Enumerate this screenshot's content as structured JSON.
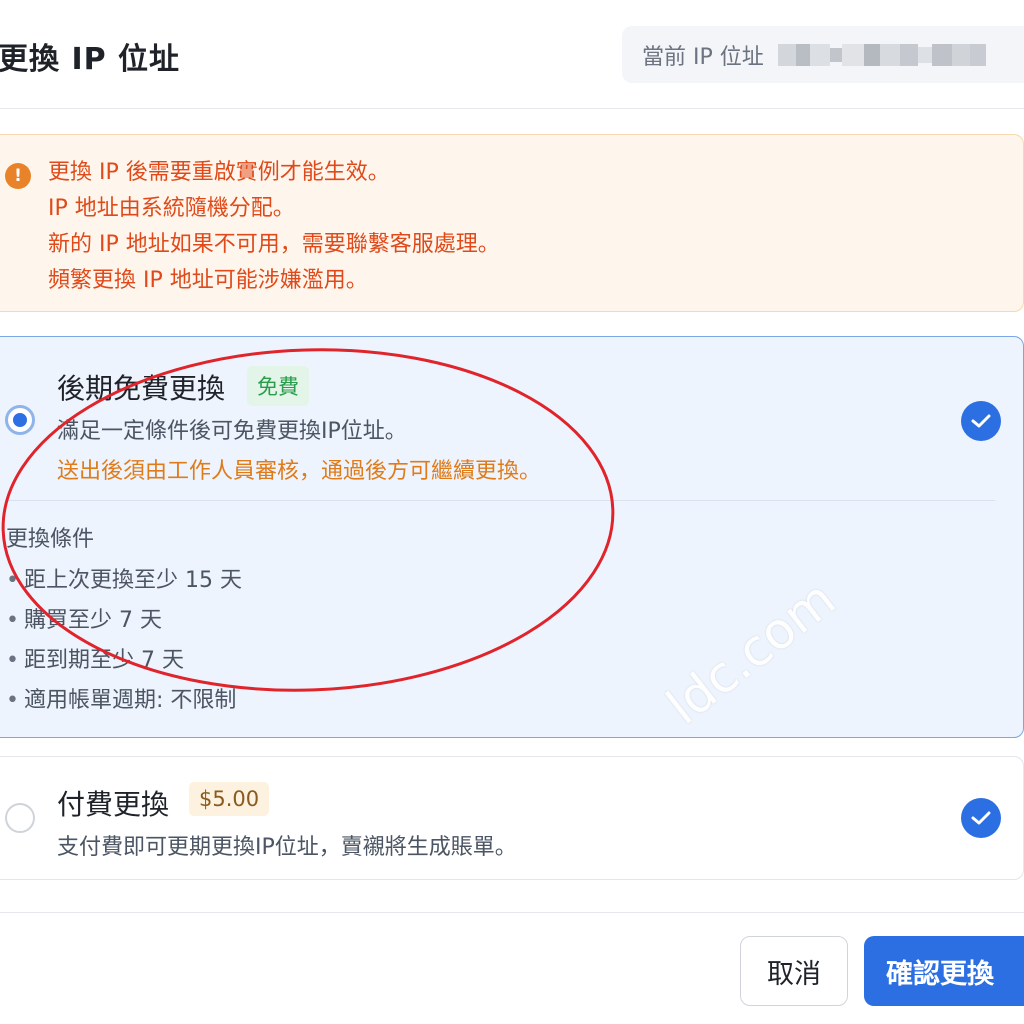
{
  "header": {
    "title": "更換 IP 位址",
    "current_ip_label": "當前 IP 位址"
  },
  "warning": {
    "icon": "exclamation-circle-icon",
    "lines": [
      "更換 IP 後需要重啟實例才能生效。",
      "IP 地址由系統隨機分配。",
      "新的 IP 地址如果不可用，需要聯繫客服處理。",
      "頻繁更換 IP 地址可能涉嫌濫用。"
    ]
  },
  "options": {
    "free": {
      "title": "後期免費更換",
      "badge": "免費",
      "description": "滿足一定條件後可免費更換IP位址。",
      "note": "送出後須由工作人員審核，通過後方可繼續更換。",
      "conditions_title": "更換條件",
      "conditions": [
        "距上次更換至少 15 天",
        "購買至少 7 天",
        "距到期至少 7 天",
        "適用帳單週期: 不限制"
      ],
      "selected": true
    },
    "paid": {
      "title": "付費更換",
      "badge": "$5.00",
      "description": "支付費即可更期更換IP位址，賣襯將生成賬單。",
      "selected": false
    }
  },
  "footer": {
    "cancel_label": "取消",
    "confirm_label": "確認更換"
  },
  "watermark": "ldc.com",
  "colors": {
    "primary": "#2c6fe2",
    "warning_text": "#e04a1a",
    "warning_bg": "#fef6ec",
    "note_orange": "#e07b1a",
    "free_badge": "#2a9d4b",
    "annotation_red": "#e0242b"
  }
}
